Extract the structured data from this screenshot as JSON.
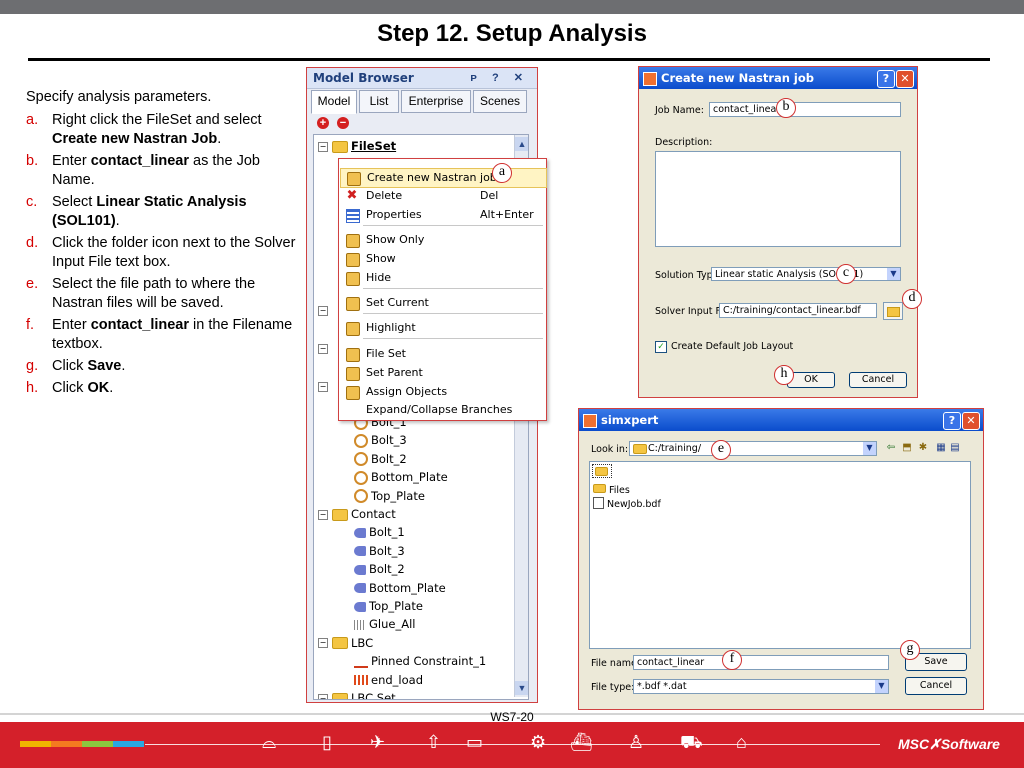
{
  "slide": {
    "title": "Step 12. Setup Analysis",
    "footer_code": "WS7-20",
    "logo": "MSC✗Software"
  },
  "instructions": {
    "intro": "Specify analysis parameters.",
    "steps": [
      {
        "marker": "a.",
        "pre": "Right click the FileSet and select ",
        "bold": "Create new Nastran Job",
        "post": "."
      },
      {
        "marker": "b.",
        "pre": "Enter ",
        "bold": "contact_linear",
        "post": " as the Job Name."
      },
      {
        "marker": "c.",
        "pre": "Select ",
        "bold": "Linear Static Analysis (SOL101)",
        "post": "."
      },
      {
        "marker": "d.",
        "pre": "Click the folder icon next to the Solver Input File text box.",
        "bold": "",
        "post": ""
      },
      {
        "marker": "e.",
        "pre": "Select the file path to where the Nastran files will be saved.",
        "bold": "",
        "post": ""
      },
      {
        "marker": "f.",
        "pre": "Enter ",
        "bold": "contact_linear",
        "post": " in the Filename textbox."
      },
      {
        "marker": "g.",
        "pre": "Click ",
        "bold": "Save",
        "post": "."
      },
      {
        "marker": "h.",
        "pre": "Click ",
        "bold": "OK",
        "post": "."
      }
    ]
  },
  "model_browser": {
    "title": "Model Browser",
    "controls": "ᴘ ? ✕",
    "tabs": [
      "Model",
      "List",
      "Enterprise",
      "Scenes"
    ],
    "selected_tab": "Model",
    "root": "FileSet",
    "tree": [
      {
        "label": "Bolt_1",
        "type": "ring",
        "indent": 1
      },
      {
        "label": "Bolt_3",
        "type": "ring",
        "indent": 1
      },
      {
        "label": "Bolt_2",
        "type": "ring",
        "indent": 1
      },
      {
        "label": "Bottom_Plate",
        "type": "ring",
        "indent": 1
      },
      {
        "label": "Top_Plate",
        "type": "ring",
        "indent": 1
      },
      {
        "label": "Contact",
        "type": "folder",
        "indent": 0
      },
      {
        "label": "Bolt_1",
        "type": "bolt",
        "indent": 1
      },
      {
        "label": "Bolt_3",
        "type": "bolt",
        "indent": 1
      },
      {
        "label": "Bolt_2",
        "type": "bolt",
        "indent": 1
      },
      {
        "label": "Bottom_Plate",
        "type": "bolt",
        "indent": 1
      },
      {
        "label": "Top_Plate",
        "type": "bolt",
        "indent": 1
      },
      {
        "label": "Glue_All",
        "type": "grid",
        "indent": 1
      },
      {
        "label": "LBC",
        "type": "folder",
        "indent": 0
      },
      {
        "label": "Pinned Constraint_1",
        "type": "pin",
        "indent": 1
      },
      {
        "label": "end_load",
        "type": "load",
        "indent": 1
      },
      {
        "label": "LBC Set",
        "type": "folder",
        "indent": 0
      }
    ]
  },
  "context_menu": {
    "items": [
      {
        "label": "Create new Nastran job",
        "shortcut": "",
        "icon": "gear-icon",
        "highlight": true
      },
      {
        "label": "Delete",
        "shortcut": "Del",
        "icon": "delete-icon"
      },
      {
        "label": "Properties",
        "shortcut": "Alt+Enter",
        "icon": "properties-icon"
      },
      {
        "label": "Show Only",
        "shortcut": "",
        "icon": "gear-icon"
      },
      {
        "label": "Show",
        "shortcut": "",
        "icon": "gear-icon"
      },
      {
        "label": "Hide",
        "shortcut": "",
        "icon": "gear-icon"
      },
      {
        "label": "Set Current",
        "shortcut": "",
        "icon": "gear-icon"
      },
      {
        "label": "Highlight",
        "shortcut": "",
        "icon": "gear-icon"
      },
      {
        "label": "File Set",
        "shortcut": "",
        "icon": "gear-icon"
      },
      {
        "label": "Set Parent",
        "shortcut": "",
        "icon": "gear-icon"
      },
      {
        "label": "Assign Objects",
        "shortcut": "",
        "icon": "gear-icon"
      },
      {
        "label": "Expand/Collapse Branches",
        "shortcut": "",
        "icon": ""
      }
    ]
  },
  "callouts": {
    "a": "a",
    "b": "b",
    "c": "c",
    "d": "d",
    "e": "e",
    "f": "f",
    "g": "g",
    "h": "h"
  },
  "nastran_dialog": {
    "title": "Create new Nastran job",
    "job_name_label": "Job Name:",
    "job_name_value": "contact_linear",
    "description_label": "Description:",
    "solution_type_label": "Solution Type:",
    "solution_type_value": "Linear static Analysis (SOL101)",
    "solver_input_label": "Solver Input File:",
    "solver_input_value": "C:/training/contact_linear.bdf",
    "checkbox_label": "Create Default Job Layout",
    "checkbox_checked": true,
    "ok": "OK",
    "cancel": "Cancel"
  },
  "save_dialog": {
    "title": "simxpert",
    "look_in_label": "Look in:",
    "look_in_value": "C:/training/",
    "files": [
      "Files",
      "NewJob.bdf"
    ],
    "file_name_label": "File name:",
    "file_name_value": "contact_linear",
    "file_type_label": "File type:",
    "file_type_value": "*.bdf *.dat",
    "save": "Save",
    "cancel": "Cancel"
  },
  "colors": {
    "footer_red": "#d4202a",
    "stripe_1": "#f0b400",
    "stripe_2": "#f47b20",
    "stripe_3": "#8cc63f",
    "stripe_4": "#2aa8e0"
  }
}
